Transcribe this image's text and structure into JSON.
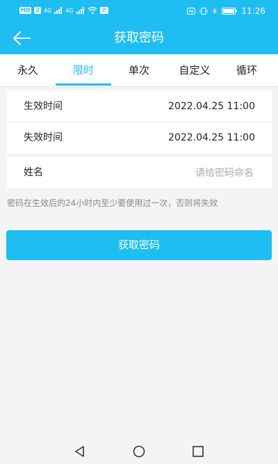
{
  "status_bar": {
    "left_badges": [
      "HD",
      "2"
    ],
    "signal_labels": [
      "4G",
      "4G"
    ],
    "time": "11:26"
  },
  "header": {
    "title": "获取密码"
  },
  "tabs": [
    {
      "label": "永久",
      "active": false
    },
    {
      "label": "限时",
      "active": true
    },
    {
      "label": "单次",
      "active": false
    },
    {
      "label": "自定义",
      "active": false
    },
    {
      "label": "循环",
      "active": false
    }
  ],
  "time_card": {
    "start_label": "生效时间",
    "start_value": "2022.04.25 11:00",
    "end_label": "失效时间",
    "end_value": "2022.04.25 11:00"
  },
  "name_card": {
    "label": "姓名",
    "placeholder": "请给密码命名",
    "value": ""
  },
  "hint": "密码在生效后的24小时内至少要使用过一次，否则将失效",
  "submit_button": "获取密码",
  "colors": {
    "accent": "#1ebdf2",
    "background": "#f4f4f6",
    "card": "#ffffff"
  }
}
